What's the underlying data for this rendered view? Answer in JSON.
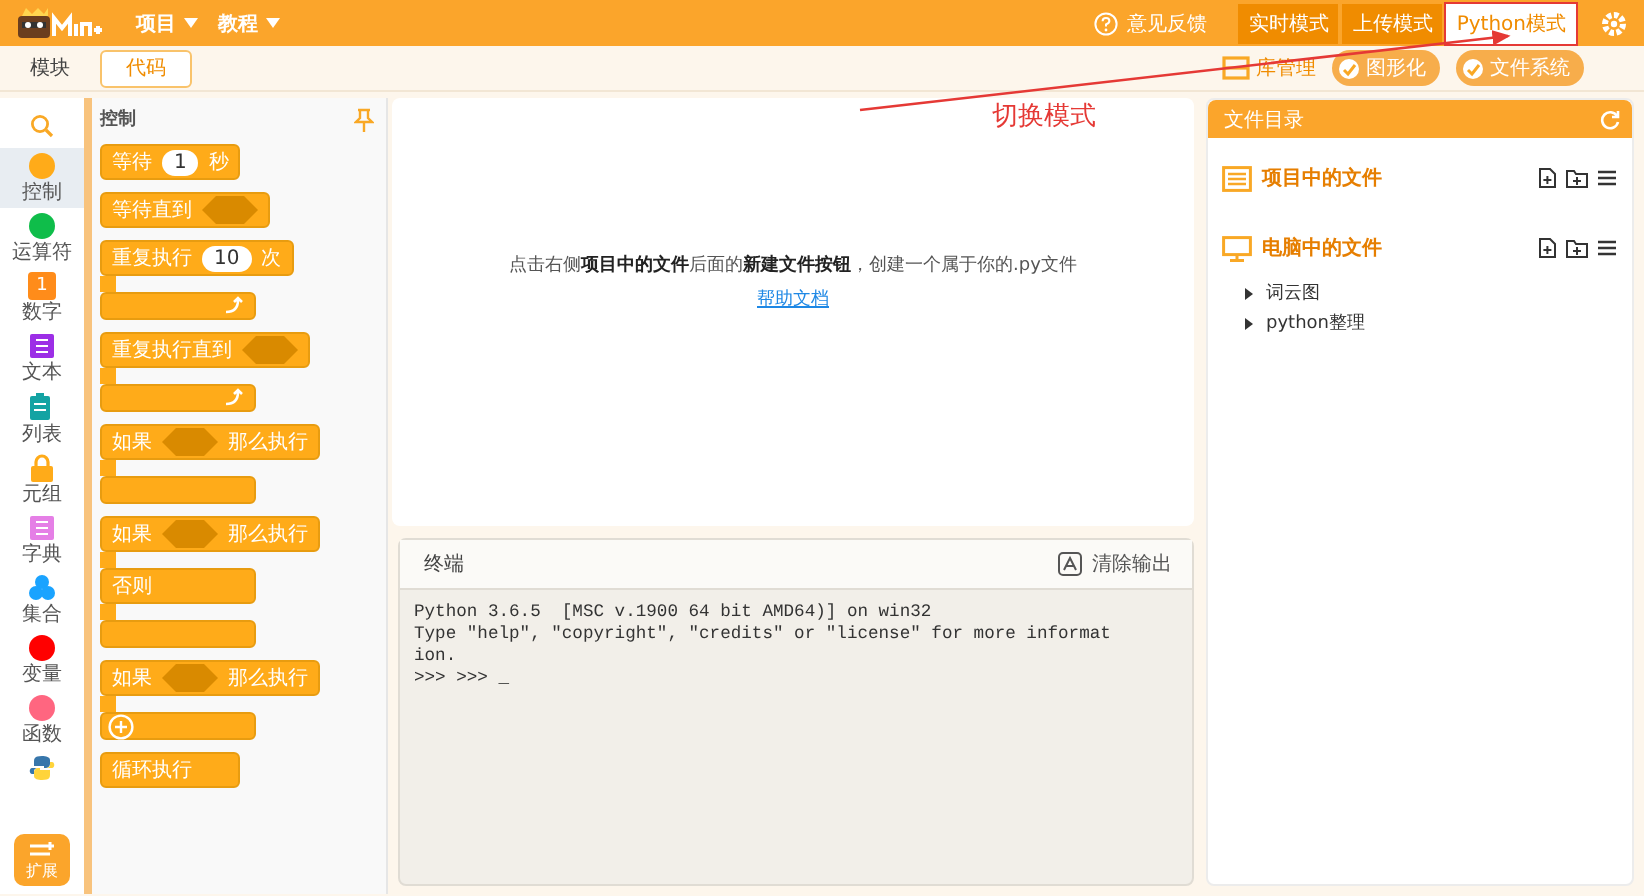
{
  "header": {
    "menus": [
      {
        "label": "项目"
      },
      {
        "label": "教程"
      }
    ],
    "feedback": "意见反馈",
    "modes": [
      {
        "label": "实时模式",
        "selected": false
      },
      {
        "label": "上传模式",
        "selected": false
      },
      {
        "label": "Python模式",
        "selected": true
      }
    ]
  },
  "toolbar": {
    "tabs": [
      {
        "label": "模块",
        "selected": false
      },
      {
        "label": "代码",
        "selected": true
      }
    ],
    "tools": [
      "库管理",
      "图形化",
      "文件系统"
    ]
  },
  "categories": [
    {
      "label": "控制",
      "kind": "dot",
      "color": "#ffab19",
      "selected": true
    },
    {
      "label": "运算符",
      "kind": "dot",
      "color": "#0fbd4a",
      "selected": false
    },
    {
      "label": "数字",
      "kind": "number",
      "color": "#ff8c1a",
      "icon_text": "1",
      "selected": false
    },
    {
      "label": "文本",
      "kind": "book",
      "color": "#9c2ee6",
      "selected": false
    },
    {
      "label": "列表",
      "kind": "clipboard",
      "color": "#14a3a3",
      "selected": false
    },
    {
      "label": "元组",
      "kind": "lock",
      "color": "#ffab19",
      "selected": false
    },
    {
      "label": "字典",
      "kind": "book",
      "color": "#e57fe6",
      "selected": false
    },
    {
      "label": "集合",
      "kind": "cluster",
      "color": "#1aa3ff",
      "selected": false
    },
    {
      "label": "变量",
      "kind": "dot",
      "color": "#ff0000",
      "selected": false
    },
    {
      "label": "函数",
      "kind": "dot",
      "color": "#ff6680",
      "selected": false
    },
    {
      "kind": "python",
      "color": "#3776ab",
      "selected": false
    }
  ],
  "extend_button": "扩展",
  "palette": {
    "title": "控制",
    "blocks": [
      {
        "kind": "stack",
        "parts": [
          {
            "kind": "text",
            "text": "等待"
          },
          {
            "kind": "input",
            "text": "1"
          },
          {
            "kind": "text",
            "text": "秒"
          }
        ]
      },
      {
        "kind": "stack",
        "parts": [
          {
            "kind": "text",
            "text": "等待直到"
          },
          {
            "kind": "hex"
          }
        ]
      },
      {
        "kind": "loop",
        "parts": [
          {
            "kind": "text",
            "text": "重复执行"
          },
          {
            "kind": "input",
            "text": "10"
          },
          {
            "kind": "text",
            "text": "次"
          }
        ]
      },
      {
        "kind": "loop",
        "parts": [
          {
            "kind": "text",
            "text": "重复执行直到"
          },
          {
            "kind": "hex"
          }
        ]
      },
      {
        "kind": "c",
        "parts": [
          {
            "kind": "text",
            "text": "如果"
          },
          {
            "kind": "hex"
          },
          {
            "kind": "text",
            "text": "那么执行"
          }
        ]
      },
      {
        "kind": "c_else",
        "parts": [
          {
            "kind": "text",
            "text": "如果"
          },
          {
            "kind": "hex"
          },
          {
            "kind": "text",
            "text": "那么执行"
          }
        ],
        "else_label": "否则"
      },
      {
        "kind": "c_plus",
        "parts": [
          {
            "kind": "text",
            "text": "如果"
          },
          {
            "kind": "hex"
          },
          {
            "kind": "text",
            "text": "那么执行"
          }
        ]
      },
      {
        "kind": "cap",
        "parts": [
          {
            "kind": "text",
            "text": "循环执行"
          }
        ]
      }
    ]
  },
  "editor": {
    "hint": "点击右侧**项目中的文件**后面的**新建文件按钮**，创建一个属于你的.py文件",
    "link": "帮助文档"
  },
  "terminal": {
    "title": "终端",
    "clear_button": "清除输出",
    "lines": [
      "Python 3.6.5  [MSC v.1900 64 bit AMD64)] on win32",
      "Type \"help\", \"copyright\", \"credits\" or \"license\" for more informat",
      "ion.",
      ">>> >>> _"
    ]
  },
  "files": {
    "title": "文件目录",
    "sections": [
      {
        "label": "项目中的文件",
        "kind": "project"
      },
      {
        "label": "电脑中的文件",
        "kind": "computer",
        "children": [
          {
            "label": "词云图",
            "expanded": false
          },
          {
            "label": "python整理",
            "expanded": false
          }
        ]
      }
    ]
  },
  "annotation": {
    "text": "切换模式"
  }
}
